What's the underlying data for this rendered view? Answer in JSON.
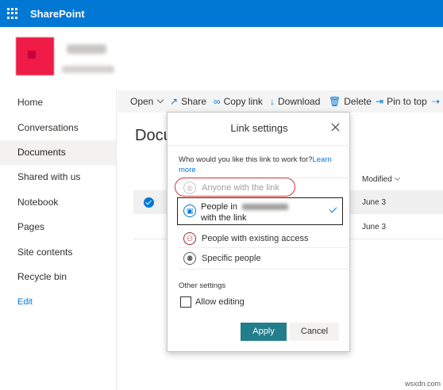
{
  "suitebar": {
    "brand": "SharePoint"
  },
  "nav": {
    "items": [
      {
        "label": "Home"
      },
      {
        "label": "Conversations"
      },
      {
        "label": "Documents",
        "active": true
      },
      {
        "label": "Shared with us"
      },
      {
        "label": "Notebook"
      },
      {
        "label": "Pages"
      },
      {
        "label": "Site contents"
      },
      {
        "label": "Recycle bin"
      }
    ],
    "edit_label": "Edit"
  },
  "commands": {
    "open": "Open",
    "share": "Share",
    "copy_link": "Copy link",
    "download": "Download",
    "delete": "Delete",
    "pin_to_top": "Pin to top"
  },
  "library": {
    "title_partial": "Docu",
    "modified_header": "Modified",
    "rows": [
      {
        "modified": "June 3",
        "selected": true
      },
      {
        "modified": "June 3",
        "selected": false
      }
    ]
  },
  "dialog": {
    "title": "Link settings",
    "question": "Who would you like this link to work for?",
    "learn_more": "Learn more",
    "options": {
      "anyone": "Anyone with the link",
      "people_in_prefix": "People in",
      "people_in_suffix": "with the link",
      "existing": "People with existing access",
      "specific": "Specific people"
    },
    "other_settings": "Other settings",
    "allow_editing": "Allow editing",
    "allow_editing_checked": false,
    "apply": "Apply",
    "cancel": "Cancel"
  },
  "colors": {
    "suitebar": "#0078d4",
    "apply_button": "#217e8a",
    "highlight_ring": "#d13438"
  },
  "watermark": "wsxdn.com"
}
